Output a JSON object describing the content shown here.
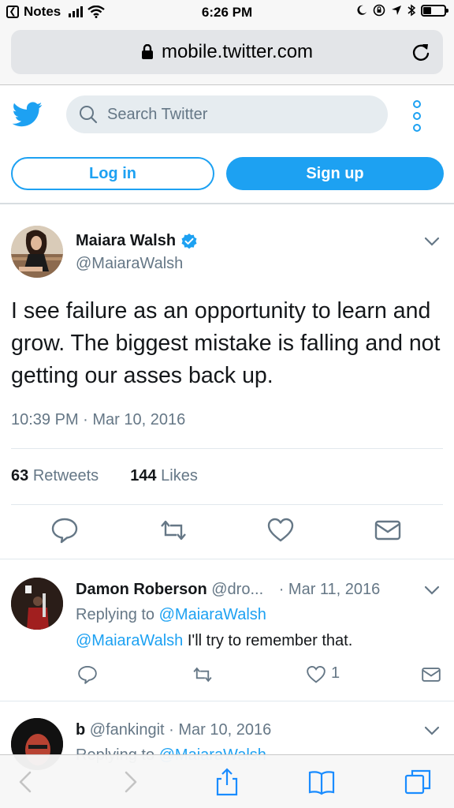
{
  "status_bar": {
    "back_app": "Notes",
    "time": "6:26 PM"
  },
  "browser": {
    "url": "mobile.twitter.com"
  },
  "header": {
    "search_placeholder": "Search Twitter",
    "login_label": "Log in",
    "signup_label": "Sign up"
  },
  "tweet": {
    "author_name": "Maiara Walsh",
    "author_handle": "@MaiaraWalsh",
    "text": "I see failure as an opportunity to learn and grow. The biggest mistake is falling and not getting our asses back up.",
    "timestamp": "10:39 PM · Mar 10, 2016",
    "retweets_count": "63",
    "retweets_label": "Retweets",
    "likes_count": "144",
    "likes_label": "Likes"
  },
  "replies": [
    {
      "name": "Damon Roberson",
      "handle": "@dro...",
      "date": "· Mar 11, 2016",
      "replying_prefix": "Replying to ",
      "replying_to": "@MaiaraWalsh",
      "mention": "@MaiaraWalsh",
      "text": " I'll try to remember that.",
      "like_count": "1"
    },
    {
      "name": "b",
      "handle": "@fankingit",
      "date": "· Mar 10, 2016",
      "replying_prefix": "Replying to ",
      "replying_to": "@MaiaraWalsh"
    }
  ],
  "colors": {
    "twitter_blue": "#1da1f2",
    "muted_text": "#657786",
    "primary_text": "#14171a"
  }
}
